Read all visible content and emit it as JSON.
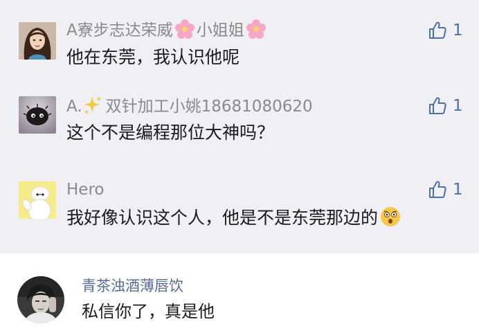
{
  "comments": [
    {
      "avatar_icon": "woman-portrait-avatar",
      "name_prefix": "A寮步志达荣威",
      "name_mid": "小姐姐",
      "name_icons": [
        "cherry-blossom-emoji",
        "cherry-blossom-emoji"
      ],
      "text": "他在东莞，我认识他呢",
      "likes": "1"
    },
    {
      "avatar_icon": "black-furball-avatar",
      "name_prefix": "A.",
      "name_icons": [
        "sparkles-emoji"
      ],
      "name_suffix": "双针加工小姚18681080620",
      "text": "这个不是编程那位大神吗？",
      "likes": "1"
    },
    {
      "avatar_icon": "white-robot-avatar",
      "name": "Hero",
      "text": "我好像认识这个人，他是不是东莞那边的",
      "text_emoji": "astonished-face-emoji",
      "likes": "1"
    }
  ],
  "reply": {
    "avatar_icon": "man-portrait-avatar",
    "name": "青茶浊酒薄唇饮",
    "text": "私信你了，真是他"
  },
  "colors": {
    "comment_background": "#efeff4",
    "reply_background": "#ffffff",
    "like_accent": "#4a6fa5",
    "reply_name": "#576b95",
    "comment_name": "#8a8a8a"
  }
}
